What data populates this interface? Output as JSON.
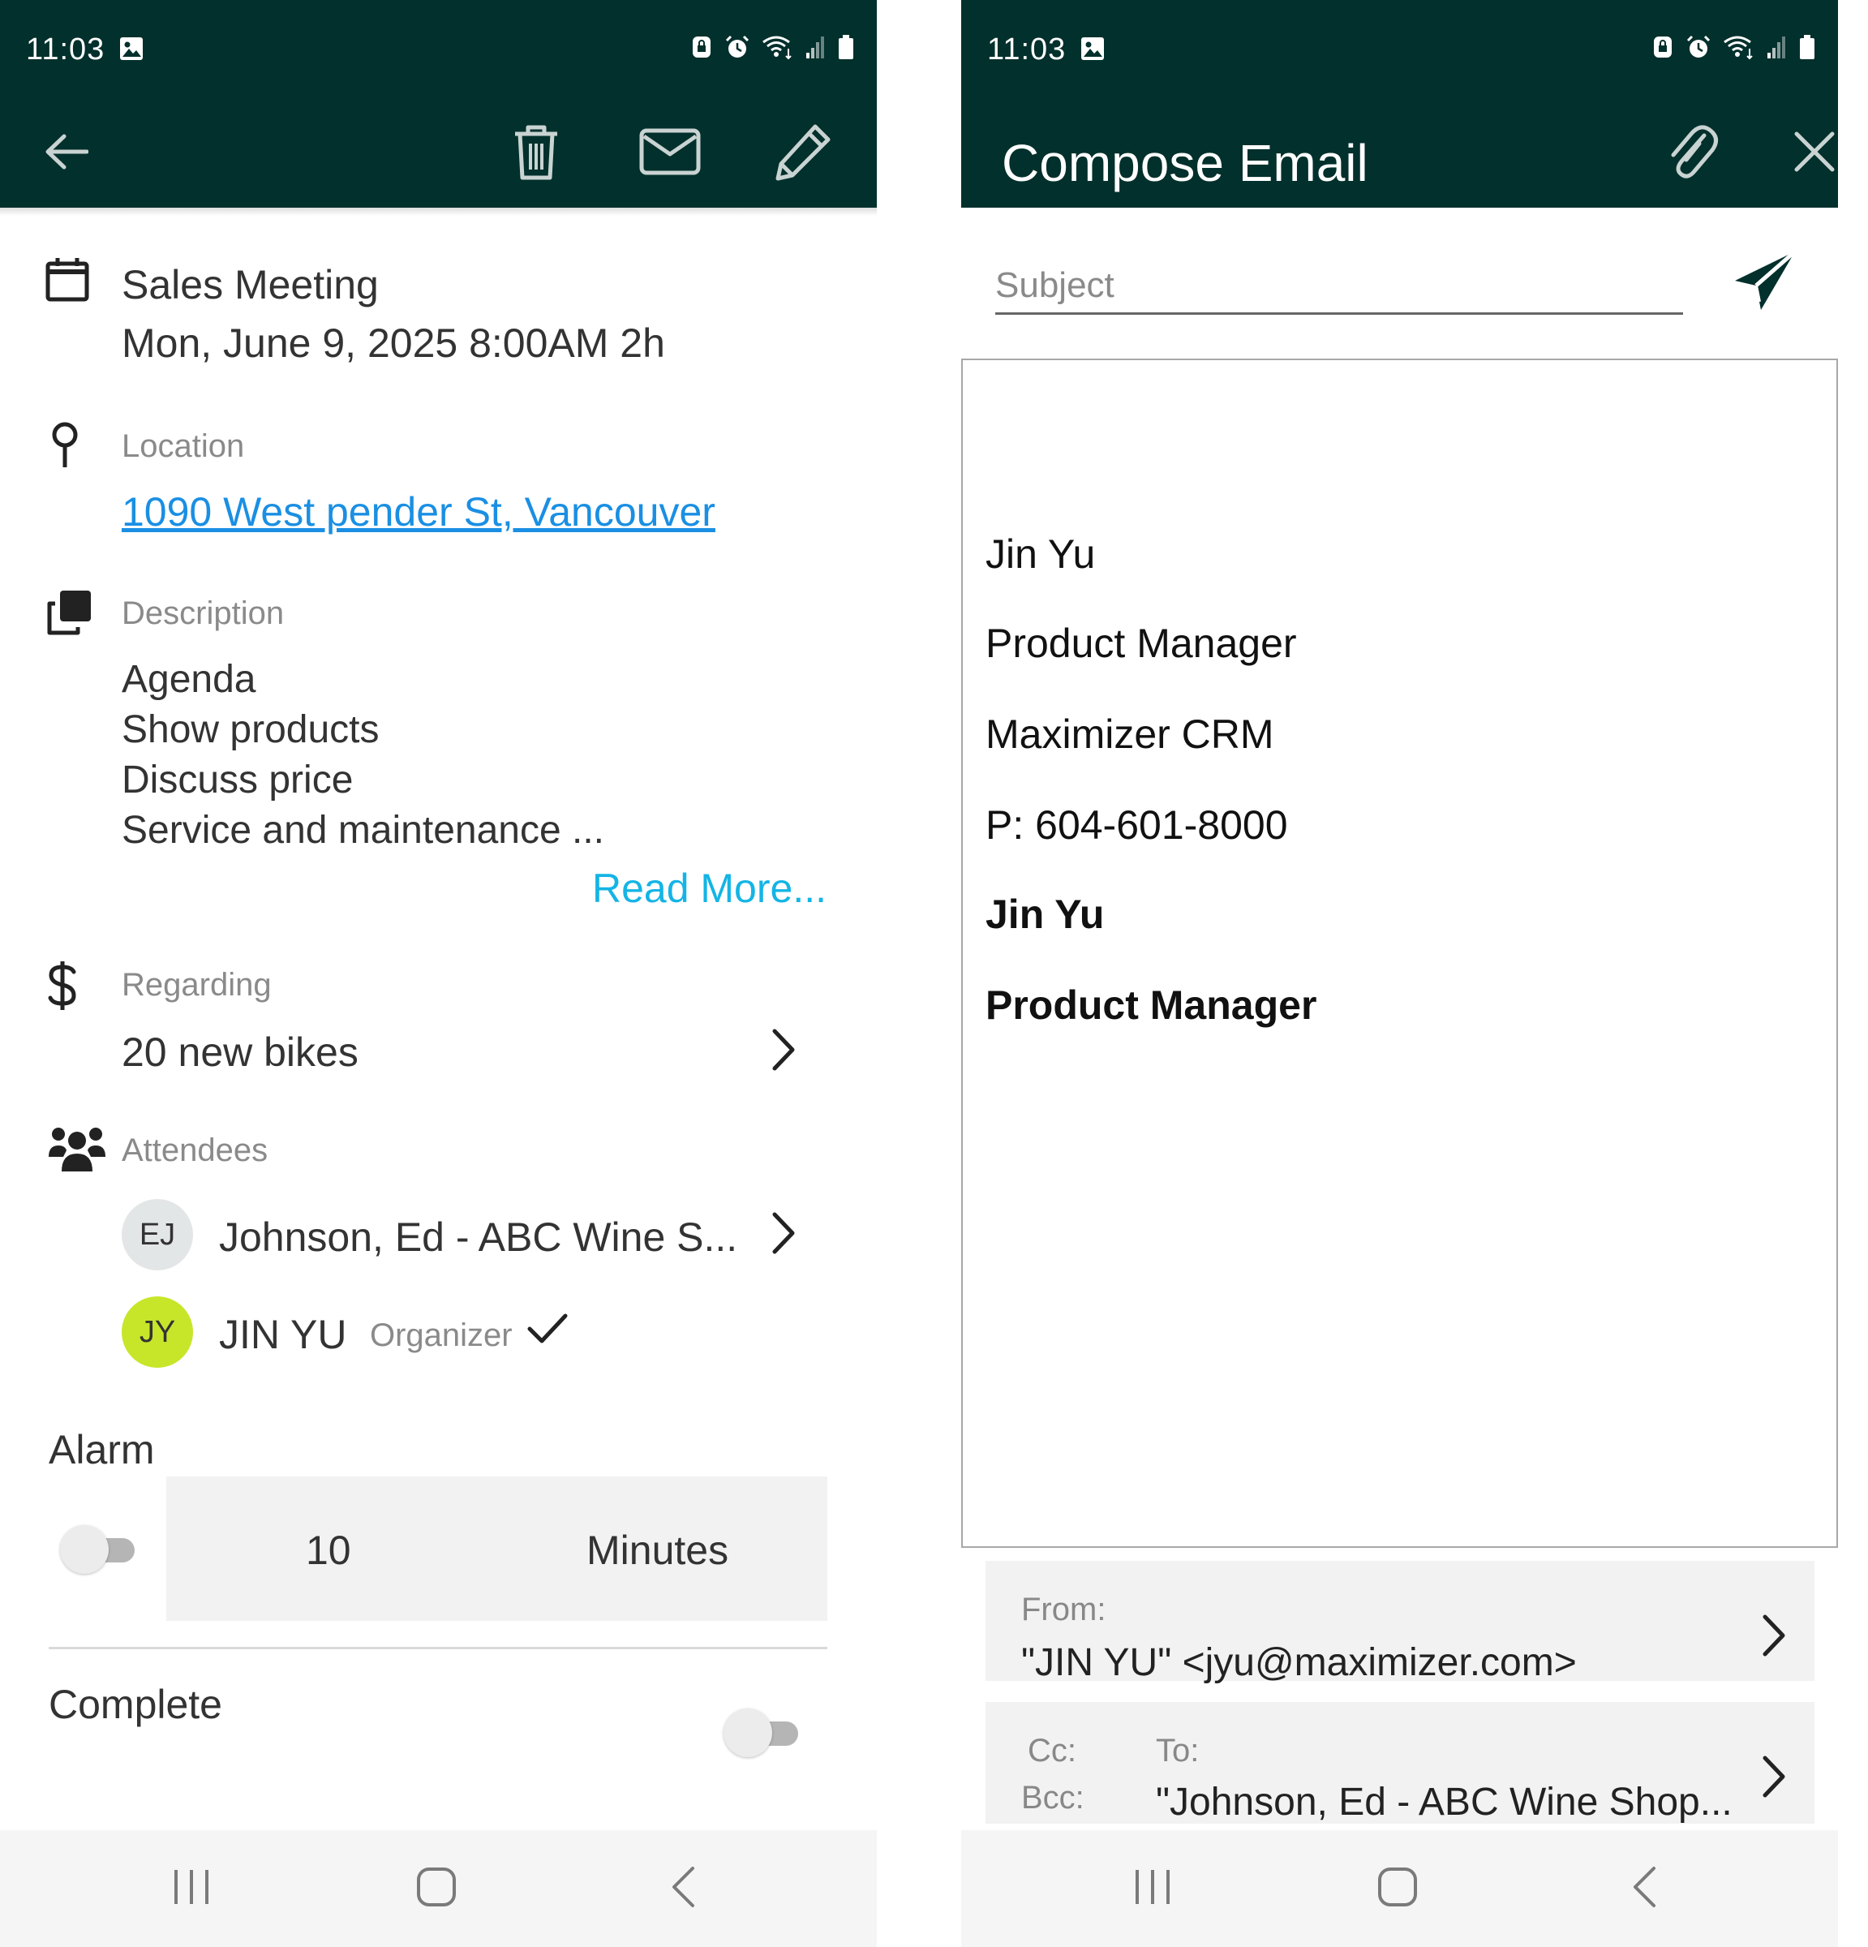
{
  "left": {
    "status": {
      "time": "11:03"
    },
    "event": {
      "title": "Sales Meeting",
      "datetime": "Mon, June 9, 2025 8:00AM 2h"
    },
    "location": {
      "label": "Location",
      "address": "1090 West pender St, Vancouver"
    },
    "description": {
      "label": "Description",
      "lines": [
        "Agenda",
        "Show products",
        "Discuss price",
        "Service and maintenance ..."
      ],
      "read_more": "Read More..."
    },
    "regarding": {
      "label": "Regarding",
      "value": "20 new bikes"
    },
    "attendees": {
      "label": "Attendees",
      "items": [
        {
          "initials": "EJ",
          "name": "Johnson, Ed - ABC Wine S...",
          "avatar_color": "#e3e6e7"
        },
        {
          "initials": "JY",
          "name": "JIN YU",
          "role": "Organizer",
          "avatar_color": "#c7e62a"
        }
      ]
    },
    "alarm": {
      "label": "Alarm",
      "value": "10",
      "unit": "Minutes",
      "enabled": false
    },
    "complete": {
      "label": "Complete",
      "enabled": false
    }
  },
  "right": {
    "status": {
      "time": "11:03"
    },
    "appbar": {
      "title": "Compose Email"
    },
    "subject": {
      "placeholder": "Subject"
    },
    "signature": {
      "lines": [
        "Jin Yu",
        "Product Manager",
        "Maximizer CRM",
        "P: 604-601-8000"
      ],
      "bold_lines": [
        "Jin Yu",
        "Product Manager"
      ]
    },
    "from": {
      "label": "From:",
      "value": "\"JIN YU\" <jyu@maximizer.com>"
    },
    "recipients": {
      "cc_label": "Cc:",
      "bcc_label": "Bcc:",
      "to_label": "To:",
      "to_value": "\"Johnson, Ed - ABC Wine Shop..."
    }
  },
  "colors": {
    "header_bg": "#02302c",
    "link": "#1a8fe3",
    "read_more": "#14b4e6"
  }
}
